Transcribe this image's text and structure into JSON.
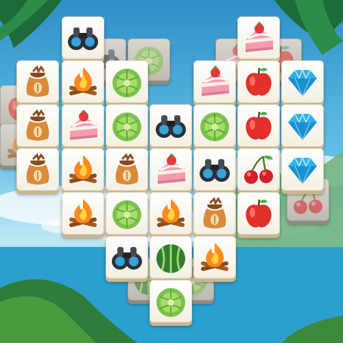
{
  "game": {
    "layout_name": "heart",
    "tile_kinds": [
      "binoculars",
      "cake",
      "apple",
      "sack",
      "campfire",
      "cabbage",
      "gem",
      "cherries",
      "watermelon"
    ],
    "top_layer": {
      "row0": [
        "binoculars",
        "cake"
      ],
      "row1": [
        "sack",
        "campfire",
        "cabbage",
        "cake",
        "apple",
        "gem"
      ],
      "row2": [
        "sack",
        "cake",
        "cabbage",
        "binoculars",
        "cabbage",
        "apple",
        "gem"
      ],
      "row3": [
        "sack",
        "campfire",
        "sack",
        "cake",
        "binoculars",
        "cherries",
        "gem"
      ],
      "row4": [
        "campfire",
        "cabbage",
        "campfire",
        "sack",
        "apple"
      ],
      "row5": [
        "binoculars",
        "watermelon",
        "campfire"
      ],
      "row6": [
        "cabbage"
      ]
    },
    "hidden_layer_visible": [
      "binoculars",
      "apple",
      "cabbage",
      "apple",
      "cake",
      "campfire",
      "cherries",
      "watermelon",
      "cabbage"
    ]
  },
  "colors": {
    "sky": "#45b4e0",
    "sea": "#2fa3cf",
    "tile_face": "#ffffff",
    "tile_edge": "#c9b78f"
  }
}
